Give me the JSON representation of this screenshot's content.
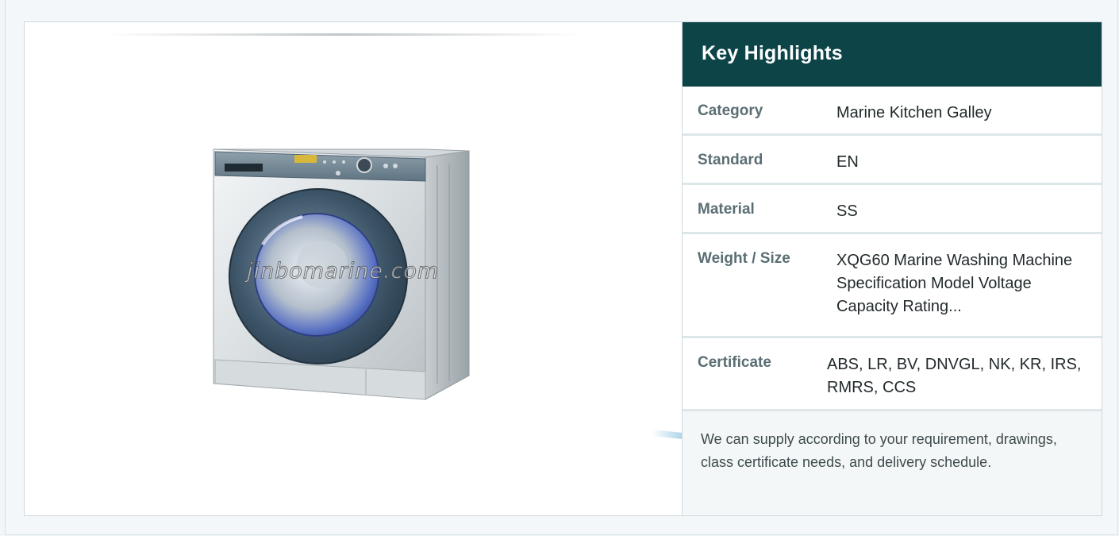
{
  "product_image": {
    "alt": "Marine washing machine",
    "watermark": "jinbomarine.com"
  },
  "highlights": {
    "title": "Key Highlights",
    "rows": [
      {
        "label": "Category",
        "value": "Marine Kitchen Galley"
      },
      {
        "label": "Standard",
        "value": "EN"
      },
      {
        "label": "Material",
        "value": "SS"
      },
      {
        "label": "Weight / Size",
        "value": "XQG60 Marine Washing Machine Specification Model Voltage Capacity Rating..."
      },
      {
        "label": "Certificate",
        "value": "ABS, LR, BV, DNVGL, NK, KR, IRS, RMRS, CCS"
      }
    ],
    "note": "We can supply according to your requirement, drawings, class certificate needs, and delivery schedule."
  },
  "colors": {
    "header_bg": "#0d4448",
    "label_text": "#5a6e74",
    "row_divider": "#dde7ea",
    "note_bg": "#f4f7f8"
  }
}
